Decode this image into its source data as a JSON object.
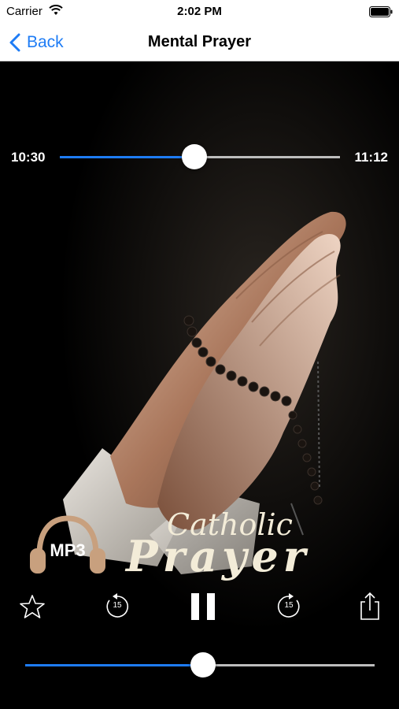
{
  "status_bar": {
    "carrier": "Carrier",
    "time": "2:02 PM",
    "wifi_icon": "wifi-icon",
    "battery_icon": "battery-icon"
  },
  "nav": {
    "back_label": "Back",
    "title": "Mental Prayer",
    "accent_color": "#1e7cf5"
  },
  "player": {
    "elapsed": "10:30",
    "total": "11:12",
    "progress_fraction": 0.48,
    "volume_fraction": 0.51,
    "artwork": {
      "subject": "praying-hands-with-rosary",
      "logo_badge": "MP3",
      "logo_line1": "Catholic",
      "logo_line2": "Prayer"
    },
    "controls": {
      "favorite_icon": "star-icon",
      "rewind_icon": "rewind-15-icon",
      "rewind_seconds": "15",
      "play_pause_icon": "pause-icon",
      "forward_icon": "forward-15-icon",
      "forward_seconds": "15",
      "share_icon": "share-icon"
    }
  }
}
